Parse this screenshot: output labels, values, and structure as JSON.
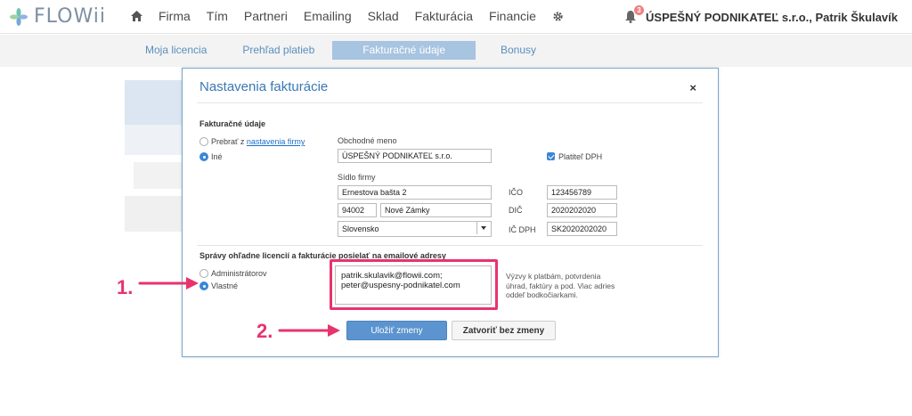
{
  "brand": {
    "name": "FLOWii"
  },
  "nav": {
    "items": [
      "Firma",
      "Tím",
      "Partneri",
      "Emailing",
      "Sklad",
      "Fakturácia",
      "Financie"
    ]
  },
  "user": {
    "notifications": "3",
    "label": "ÚSPEŠNÝ PODNIKATEĽ s.r.o., Patrik Škulavík"
  },
  "subtabs": [
    "Moja licencia",
    "Prehľad platieb",
    "Fakturačné údaje",
    "Bonusy"
  ],
  "modal": {
    "title": "Nastavenia fakturácie",
    "close": "×",
    "billing_section": "Fakturačné údaje",
    "radio_take_prefix": "Prebrať z ",
    "radio_take_link": "nastavenia firmy",
    "radio_other": "Iné",
    "company_name_label": "Obchodné meno",
    "company_name": "ÚSPEŠNÝ PODNIKATEĽ s.r.o.",
    "vat_payer_label": "Platiteľ DPH",
    "seat_label": "Sídlo firmy",
    "street": "Ernestova bašta 2",
    "zip": "94002",
    "city": "Nové Zámky",
    "country": "Slovensko",
    "ico_label": "IČO",
    "ico": "123456789",
    "dic_label": "DIČ",
    "dic": "2020202020",
    "icdph_label": "IČ DPH",
    "icdph": "SK2020202020",
    "email_section": "Správy ohľadne licencií a fakturácie posielať na emailové adresy",
    "radio_admins": "Administrátorov",
    "radio_own": "Vlastné",
    "emails_line1": "patrik.skulavik@flowii.com;",
    "emails_line2": "peter@uspesny-podnikatel.com",
    "hint": "Výzvy k platbám, potvrdenia úhrad, faktúry a pod. Viac adries oddeľ bodkočiarkami.",
    "save_button": "Uložiť zmeny",
    "close_button": "Zatvoriť bez zmeny"
  },
  "annotations": {
    "step1": "1.",
    "step2": "2."
  },
  "colors": {
    "accent": "#3a86d6",
    "highlight": "#e8336d",
    "subtab_active": "#a7c4e0"
  }
}
